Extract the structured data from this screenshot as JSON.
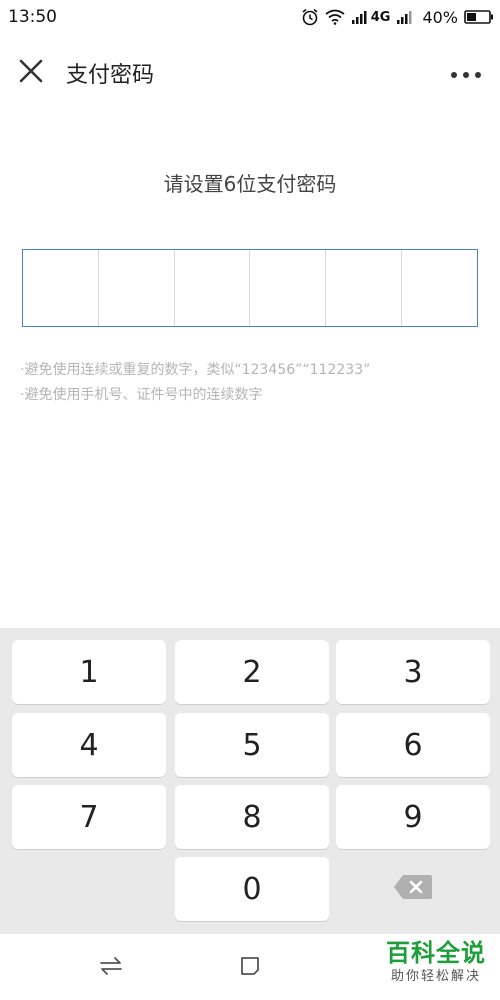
{
  "status_bar": {
    "time": "13:50",
    "network": "4G",
    "battery": "40%"
  },
  "header": {
    "title": "支付密码"
  },
  "instruction": "请设置6位支付密码",
  "pin": {
    "length": 6,
    "filled": 0
  },
  "hints": [
    "·避免使用连续或重复的数字，类似“123456”“112233”",
    "·避免使用手机号、证件号中的连续数字"
  ],
  "keypad": {
    "keys": [
      "1",
      "2",
      "3",
      "4",
      "5",
      "6",
      "7",
      "8",
      "9",
      "0"
    ]
  },
  "watermark": {
    "title": "百科全说",
    "subtitle": "助你轻松解决"
  },
  "colors": {
    "accent": "#4a7ed8",
    "keyboard_bg": "#e9e9e9",
    "watermark": "#1e9e3a"
  }
}
